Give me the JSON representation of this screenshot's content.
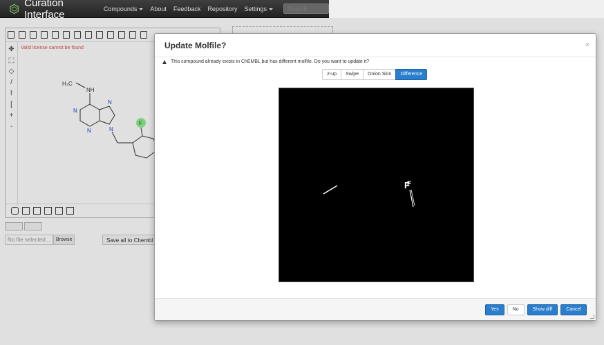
{
  "navbar": {
    "brand": "Curation Interface",
    "items": [
      {
        "label": "Compounds",
        "dropdown": true
      },
      {
        "label": "About",
        "dropdown": false
      },
      {
        "label": "Feedback",
        "dropdown": false
      },
      {
        "label": "Repository",
        "dropdown": false
      },
      {
        "label": "Settings",
        "dropdown": true
      }
    ],
    "search_placeholder": "Search"
  },
  "editor": {
    "license_warning": "Valid license cannot be found",
    "molecule": {
      "h3c": "H₃C",
      "nh": "NH",
      "n1": "N",
      "n2": "N",
      "n3": "N",
      "n4": "N",
      "f": "F"
    }
  },
  "file": {
    "placeholder": "No file selected...",
    "browse_label": "Browse",
    "save_label": "Save all to Chembl"
  },
  "modal": {
    "title": "Update Molfile?",
    "close_glyph": "×",
    "message": "This compound already exists in ChEMBL but has different molfile. Do you want to update it?",
    "view_modes": [
      {
        "label": "2-up",
        "active": false
      },
      {
        "label": "Swipe",
        "active": false
      },
      {
        "label": "Onion Skin",
        "active": false
      },
      {
        "label": "Difference",
        "active": true
      }
    ],
    "diff_text": "F",
    "buttons": {
      "yes": "Yes",
      "no": "No",
      "show_diff": "Show diff",
      "cancel": "Cancel"
    }
  },
  "colors": {
    "primary": "#2a7ecc",
    "navbar": "#222222",
    "warning_text": "#d9534f",
    "highlight_green": "#90ee90"
  }
}
